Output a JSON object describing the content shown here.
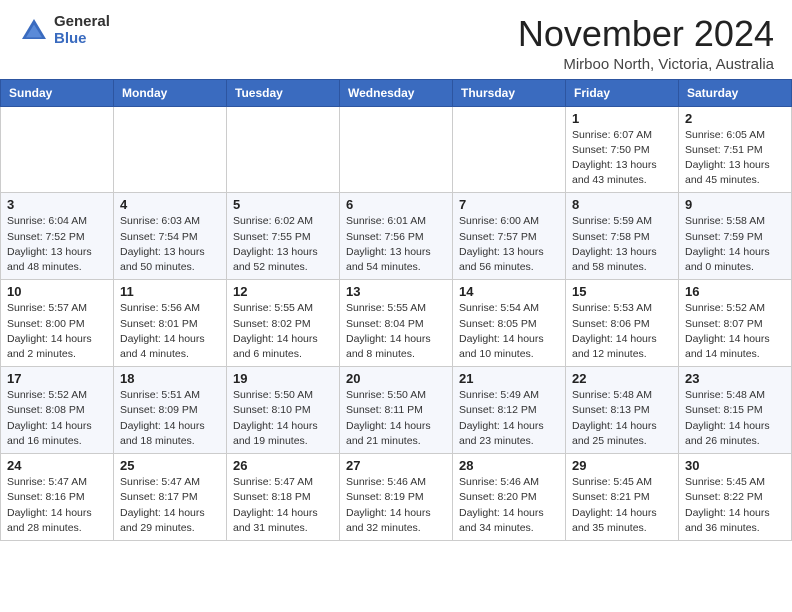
{
  "header": {
    "logo_general": "General",
    "logo_blue": "Blue",
    "month_title": "November 2024",
    "subtitle": "Mirboo North, Victoria, Australia"
  },
  "days_of_week": [
    "Sunday",
    "Monday",
    "Tuesday",
    "Wednesday",
    "Thursday",
    "Friday",
    "Saturday"
  ],
  "weeks": [
    [
      {
        "day": "",
        "info": ""
      },
      {
        "day": "",
        "info": ""
      },
      {
        "day": "",
        "info": ""
      },
      {
        "day": "",
        "info": ""
      },
      {
        "day": "",
        "info": ""
      },
      {
        "day": "1",
        "info": "Sunrise: 6:07 AM\nSunset: 7:50 PM\nDaylight: 13 hours\nand 43 minutes."
      },
      {
        "day": "2",
        "info": "Sunrise: 6:05 AM\nSunset: 7:51 PM\nDaylight: 13 hours\nand 45 minutes."
      }
    ],
    [
      {
        "day": "3",
        "info": "Sunrise: 6:04 AM\nSunset: 7:52 PM\nDaylight: 13 hours\nand 48 minutes."
      },
      {
        "day": "4",
        "info": "Sunrise: 6:03 AM\nSunset: 7:54 PM\nDaylight: 13 hours\nand 50 minutes."
      },
      {
        "day": "5",
        "info": "Sunrise: 6:02 AM\nSunset: 7:55 PM\nDaylight: 13 hours\nand 52 minutes."
      },
      {
        "day": "6",
        "info": "Sunrise: 6:01 AM\nSunset: 7:56 PM\nDaylight: 13 hours\nand 54 minutes."
      },
      {
        "day": "7",
        "info": "Sunrise: 6:00 AM\nSunset: 7:57 PM\nDaylight: 13 hours\nand 56 minutes."
      },
      {
        "day": "8",
        "info": "Sunrise: 5:59 AM\nSunset: 7:58 PM\nDaylight: 13 hours\nand 58 minutes."
      },
      {
        "day": "9",
        "info": "Sunrise: 5:58 AM\nSunset: 7:59 PM\nDaylight: 14 hours\nand 0 minutes."
      }
    ],
    [
      {
        "day": "10",
        "info": "Sunrise: 5:57 AM\nSunset: 8:00 PM\nDaylight: 14 hours\nand 2 minutes."
      },
      {
        "day": "11",
        "info": "Sunrise: 5:56 AM\nSunset: 8:01 PM\nDaylight: 14 hours\nand 4 minutes."
      },
      {
        "day": "12",
        "info": "Sunrise: 5:55 AM\nSunset: 8:02 PM\nDaylight: 14 hours\nand 6 minutes."
      },
      {
        "day": "13",
        "info": "Sunrise: 5:55 AM\nSunset: 8:04 PM\nDaylight: 14 hours\nand 8 minutes."
      },
      {
        "day": "14",
        "info": "Sunrise: 5:54 AM\nSunset: 8:05 PM\nDaylight: 14 hours\nand 10 minutes."
      },
      {
        "day": "15",
        "info": "Sunrise: 5:53 AM\nSunset: 8:06 PM\nDaylight: 14 hours\nand 12 minutes."
      },
      {
        "day": "16",
        "info": "Sunrise: 5:52 AM\nSunset: 8:07 PM\nDaylight: 14 hours\nand 14 minutes."
      }
    ],
    [
      {
        "day": "17",
        "info": "Sunrise: 5:52 AM\nSunset: 8:08 PM\nDaylight: 14 hours\nand 16 minutes."
      },
      {
        "day": "18",
        "info": "Sunrise: 5:51 AM\nSunset: 8:09 PM\nDaylight: 14 hours\nand 18 minutes."
      },
      {
        "day": "19",
        "info": "Sunrise: 5:50 AM\nSunset: 8:10 PM\nDaylight: 14 hours\nand 19 minutes."
      },
      {
        "day": "20",
        "info": "Sunrise: 5:50 AM\nSunset: 8:11 PM\nDaylight: 14 hours\nand 21 minutes."
      },
      {
        "day": "21",
        "info": "Sunrise: 5:49 AM\nSunset: 8:12 PM\nDaylight: 14 hours\nand 23 minutes."
      },
      {
        "day": "22",
        "info": "Sunrise: 5:48 AM\nSunset: 8:13 PM\nDaylight: 14 hours\nand 25 minutes."
      },
      {
        "day": "23",
        "info": "Sunrise: 5:48 AM\nSunset: 8:15 PM\nDaylight: 14 hours\nand 26 minutes."
      }
    ],
    [
      {
        "day": "24",
        "info": "Sunrise: 5:47 AM\nSunset: 8:16 PM\nDaylight: 14 hours\nand 28 minutes."
      },
      {
        "day": "25",
        "info": "Sunrise: 5:47 AM\nSunset: 8:17 PM\nDaylight: 14 hours\nand 29 minutes."
      },
      {
        "day": "26",
        "info": "Sunrise: 5:47 AM\nSunset: 8:18 PM\nDaylight: 14 hours\nand 31 minutes."
      },
      {
        "day": "27",
        "info": "Sunrise: 5:46 AM\nSunset: 8:19 PM\nDaylight: 14 hours\nand 32 minutes."
      },
      {
        "day": "28",
        "info": "Sunrise: 5:46 AM\nSunset: 8:20 PM\nDaylight: 14 hours\nand 34 minutes."
      },
      {
        "day": "29",
        "info": "Sunrise: 5:45 AM\nSunset: 8:21 PM\nDaylight: 14 hours\nand 35 minutes."
      },
      {
        "day": "30",
        "info": "Sunrise: 5:45 AM\nSunset: 8:22 PM\nDaylight: 14 hours\nand 36 minutes."
      }
    ]
  ]
}
